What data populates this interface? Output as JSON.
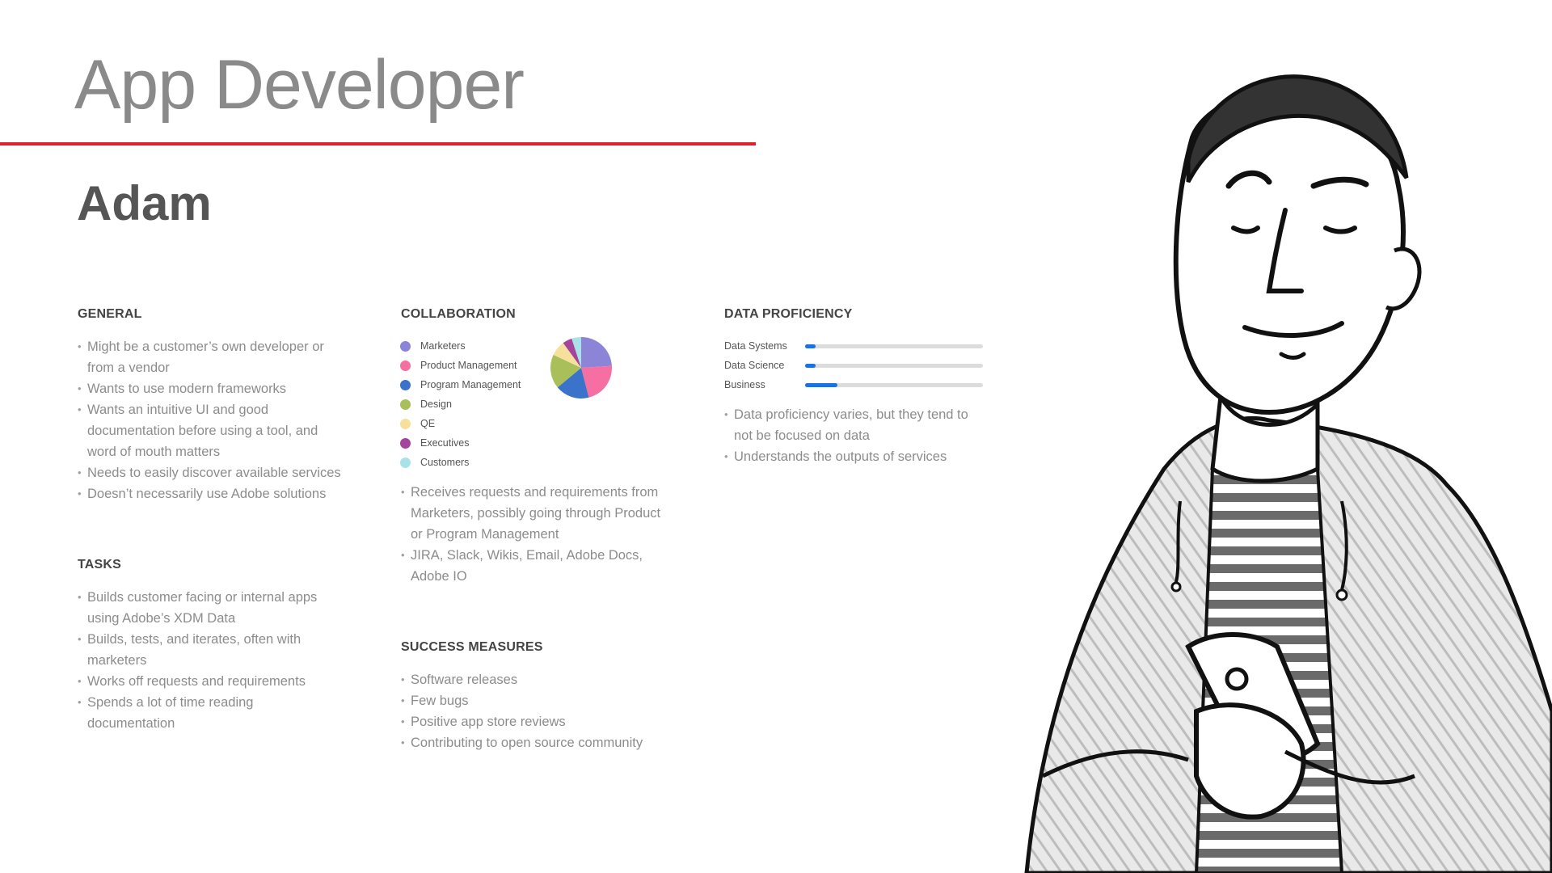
{
  "header": {
    "role_title": "App Developer",
    "persona_name": "Adam",
    "accent_color": "#e2202a"
  },
  "general": {
    "heading": "GENERAL",
    "bullets": [
      "Might be a customer’s own developer or from a vendor",
      "Wants to use modern frameworks",
      "Wants an intuitive UI and good documentation before using a tool, and word of mouth matters",
      "Needs to easily discover available services",
      "Doesn’t necessarily use Adobe solutions"
    ]
  },
  "tasks": {
    "heading": "TASKS",
    "bullets": [
      "Builds customer facing or internal apps using Adobe’s XDM Data",
      "Builds, tests, and iterates, often with marketers",
      "Works off requests and requirements",
      "Spends a lot of time reading documentation"
    ]
  },
  "collaboration": {
    "heading": "COLLABORATION",
    "legend": [
      {
        "label": "Marketers",
        "color": "#8b84d7",
        "share": 24
      },
      {
        "label": "Product Management",
        "color": "#f56fa2",
        "share": 22
      },
      {
        "label": "Program Management",
        "color": "#3a73c9",
        "share": 18
      },
      {
        "label": "Design",
        "color": "#a8bf5a",
        "share": 18
      },
      {
        "label": "QE",
        "color": "#f7e09b",
        "share": 8
      },
      {
        "label": "Executives",
        "color": "#a4449b",
        "share": 5
      },
      {
        "label": "Customers",
        "color": "#a8e2e6",
        "share": 5
      }
    ],
    "bullets": [
      "Receives requests and requirements from Marketers, possibly going through Product or Program Management",
      "JIRA, Slack, Wikis, Email, Adobe Docs, Adobe IO"
    ]
  },
  "success_measures": {
    "heading": "SUCCESS MEASURES",
    "bullets": [
      "Software releases",
      "Few bugs",
      "Positive app store reviews",
      "Contributing to open source community"
    ]
  },
  "data_proficiency": {
    "heading": "DATA PROFICIENCY",
    "bar_color": "#1473e6",
    "bars": [
      {
        "label": "Data Systems",
        "level": 0.06
      },
      {
        "label": "Data Science",
        "level": 0.06
      },
      {
        "label": "Business",
        "level": 0.18
      }
    ],
    "bullets": [
      "Data proficiency varies, but they tend to not be focused on data",
      "Understands the outputs of services"
    ]
  },
  "illustration": {
    "icon": "persona-sketch-illustration"
  }
}
